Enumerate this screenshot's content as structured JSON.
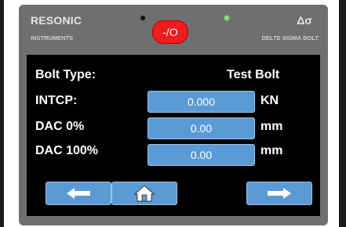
{
  "header": {
    "brand_title": "RESONIC",
    "brand_subtitle": "INSTRUMENTS",
    "power_label": "-/O",
    "product_title": "Δσ",
    "product_subtitle": "DELTE SIGMA BOLT",
    "led_colors": {
      "left": "#111111",
      "right": "#7ce37c"
    },
    "power_color": "#ee1c1c"
  },
  "screen": {
    "bolt_type_label": "Bolt Type:",
    "bolt_type_value": "Test Bolt",
    "rows": [
      {
        "label": "INTCP:",
        "value": "0.000",
        "unit": "KN"
      },
      {
        "label": "DAC 0%",
        "value": "0.00",
        "unit": "mm"
      },
      {
        "label": "DAC 100%",
        "value": "0.00",
        "unit": "mm"
      }
    ],
    "field_color": "#5b9bd5"
  },
  "nav": {
    "back_icon": "arrow-left-icon",
    "home_icon": "home-icon",
    "forward_icon": "arrow-right-icon"
  }
}
